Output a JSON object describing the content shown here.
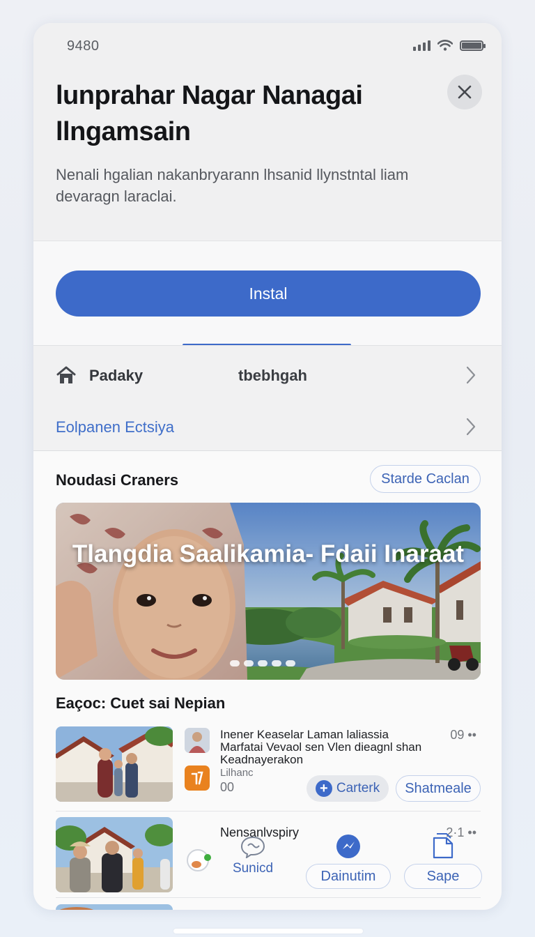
{
  "status": {
    "time": "9480"
  },
  "header": {
    "title": "lunprahar Nagar Nanagai llngamsain",
    "subtitle": "Nenali hgalian nakanbryarann lhsanid llynstntal liam devaragn laraclai."
  },
  "install": {
    "label": "Instal"
  },
  "info": {
    "row1_label": "Padaky",
    "row1_value": "tbebhgah",
    "row2_link": "Eolpanen Ectsiya"
  },
  "featured": {
    "section_title": "Noudasi Craners",
    "see_all": "Starde Caclan",
    "hero_title": "Tlangdia Saalikamia- Fdaii Inaraat",
    "dot_count": 5
  },
  "list": {
    "title": "Eaçoc: Cuet sai Nepian",
    "items": [
      {
        "title": "Inener Keaselar Laman laliassia",
        "description": "Marfatai Vevaol sen Vlen dieagnl shan Keadnayerakon",
        "sub": "Lilhanc",
        "count": "00",
        "meta": "09 ••",
        "primary_action": "Carterk",
        "secondary_action": "Shatmeale"
      },
      {
        "title": "Nensanlvspiry",
        "meta": "2·1 ••",
        "action_1": "Sunicd",
        "action_2": "Dainutim",
        "action_3": "Sape"
      }
    ]
  },
  "colors": {
    "accent": "#3d6ac9",
    "link": "#3f6ec9",
    "background": "#fafafa"
  }
}
